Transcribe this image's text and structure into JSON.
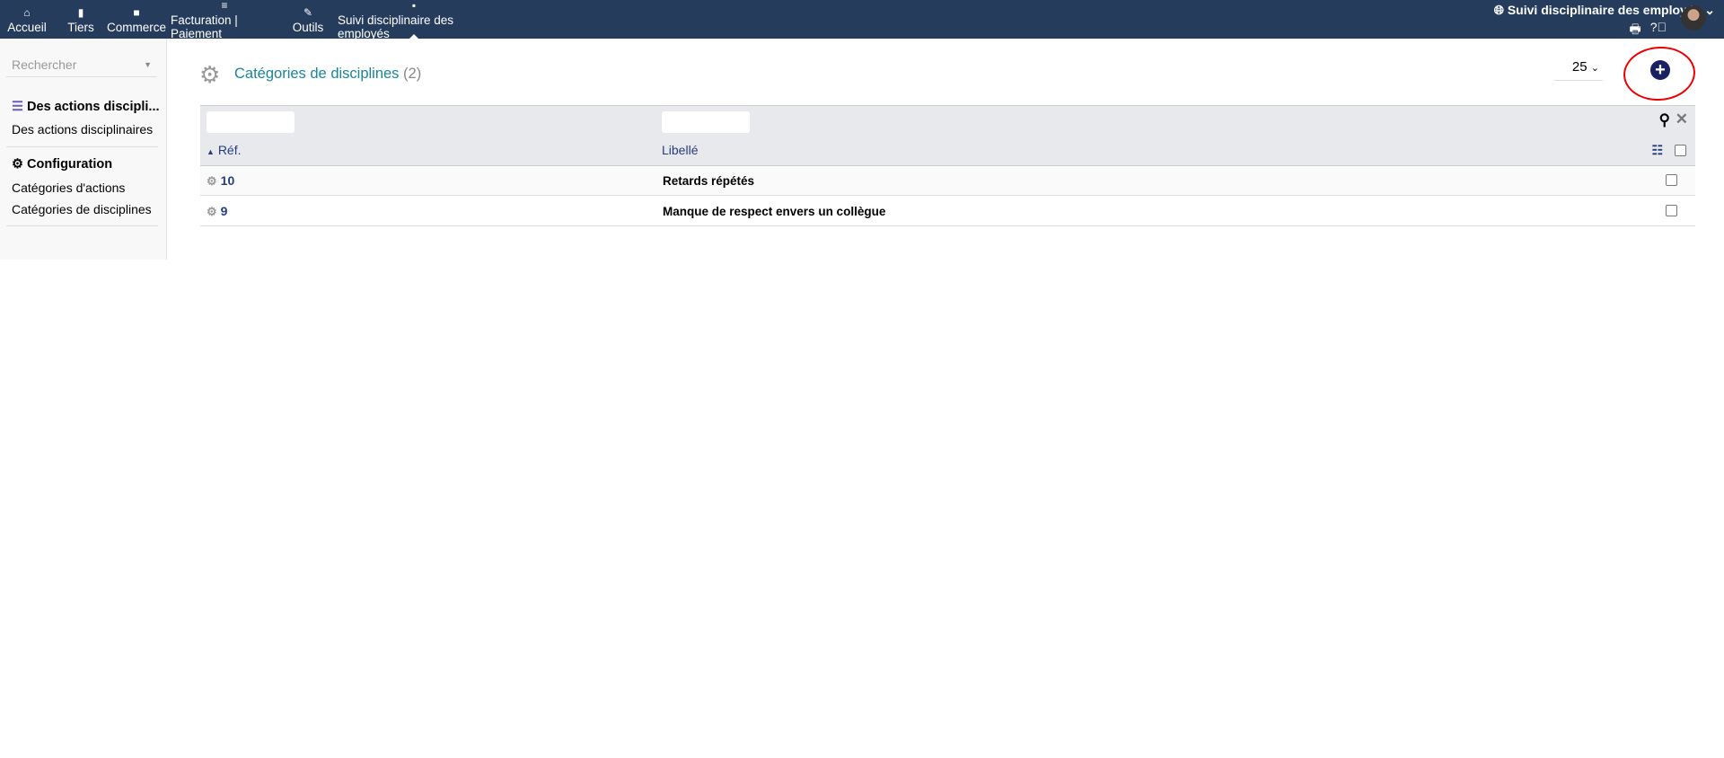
{
  "topbar": {
    "menu": [
      {
        "label": "Accueil",
        "icon": "home-icon"
      },
      {
        "label": "Tiers",
        "icon": "building-icon"
      },
      {
        "label": "Commerce",
        "icon": "briefcase-icon"
      },
      {
        "label": "Facturation | Paiement",
        "icon": "coins-icon"
      },
      {
        "label": "Outils",
        "icon": "wrench-icon"
      },
      {
        "label": "Suivi disciplinaire des employés",
        "icon": "note-icon"
      }
    ],
    "module_title": "Suivi disciplinaire des employés"
  },
  "sidebar": {
    "search_placeholder": "Rechercher",
    "section1_title": "Des actions discipli...",
    "section1_items": [
      "Des actions disciplinaires"
    ],
    "section2_title": "Configuration",
    "section2_items": [
      "Catégories d'actions",
      "Catégories de disciplines"
    ]
  },
  "main": {
    "title": "Catégories de disciplines",
    "count": "(2)",
    "limit": "25",
    "columns": [
      "Réf.",
      "Libellé"
    ],
    "rows": [
      {
        "ref": "10",
        "label": "Retards répétés"
      },
      {
        "ref": "9",
        "label": "Manque de respect envers un collègue"
      }
    ]
  },
  "colors": {
    "topbar": "#263c5c",
    "accent": "#1a8597",
    "link": "#263c7c",
    "annotation": "#e00000"
  }
}
